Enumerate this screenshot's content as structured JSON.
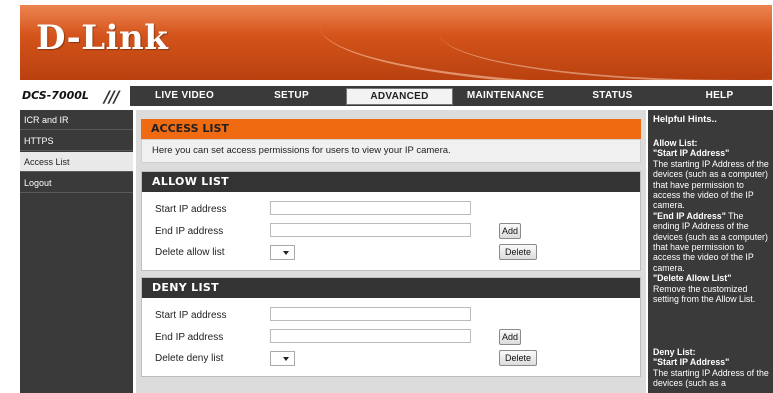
{
  "brand": {
    "logo": "D-Link"
  },
  "nav": {
    "model": "DCS-7000L",
    "tabs": [
      "LIVE VIDEO",
      "SETUP",
      "ADVANCED",
      "MAINTENANCE",
      "STATUS",
      "HELP"
    ],
    "active_tab": "ADVANCED"
  },
  "sidebar": {
    "items": [
      {
        "label": "ICR and IR"
      },
      {
        "label": "HTTPS"
      },
      {
        "label": "Access List",
        "active": true
      },
      {
        "label": "Logout"
      }
    ]
  },
  "main": {
    "title": "ACCESS LIST",
    "description": "Here you can set access permissions for users to view your IP camera.",
    "allow": {
      "heading": "ALLOW LIST",
      "start_label": "Start IP address",
      "start_value": "",
      "end_label": "End IP address",
      "end_value": "",
      "delete_label": "Delete allow list",
      "add_button": "Add",
      "delete_button": "Delete"
    },
    "deny": {
      "heading": "DENY LIST",
      "start_label": "Start IP address",
      "start_value": "",
      "end_label": "End IP address",
      "end_value": "",
      "delete_label": "Delete deny list",
      "add_button": "Add",
      "delete_button": "Delete"
    }
  },
  "help": {
    "heading": "Helpful Hints..",
    "allow_title": "Allow List:",
    "allow_start_title": "\"Start IP Address\"",
    "allow_start_text": "The starting IP Address of the devices (such as a computer) that have permission to access the video of the IP camera.",
    "allow_end_title": "\"End IP Address\"",
    "allow_end_text": "The ending IP Address of the devices (such as a computer) that have permission to access the video of the IP camera.",
    "allow_delete_title": "\"Delete Allow List\"",
    "allow_delete_text": "Remove the customized setting from the Allow List.",
    "deny_title": "Deny List:",
    "deny_start_title": "\"Start IP Address\"",
    "deny_start_text": "The starting IP Address of the devices (such as a"
  },
  "colors": {
    "banner_orange": "#d4541b",
    "accent_orange": "#ef6a10",
    "dark_bar": "#3a3a3a",
    "section_head": "#333333"
  }
}
